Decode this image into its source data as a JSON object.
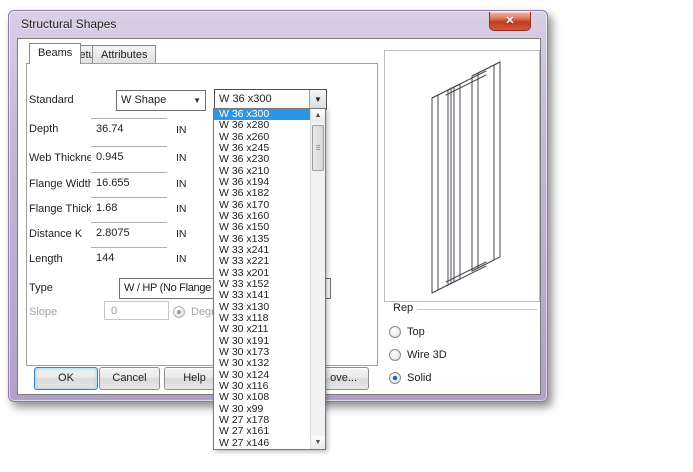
{
  "window": {
    "title": "Structural Shapes",
    "close_label": "x"
  },
  "tabs": [
    {
      "label": "Beams",
      "active": true
    },
    {
      "label": "Setup",
      "active": false
    },
    {
      "label": "Attributes",
      "active": false
    }
  ],
  "form": {
    "standard_label": "Standard",
    "shape_combo_value": "W Shape",
    "size_combo_value": "W 36 x300",
    "fields": [
      {
        "label": "Depth",
        "value": "36.74",
        "unit": "IN"
      },
      {
        "label": "Web Thickness",
        "value": "0.945",
        "unit": "IN"
      },
      {
        "label": "Flange Width",
        "value": "16.655",
        "unit": "IN"
      },
      {
        "label": "Flange Thickness",
        "value": "1.68",
        "unit": "IN"
      },
      {
        "label": "Distance K",
        "value": "2.8075",
        "unit": "IN"
      },
      {
        "label": "Length",
        "value": "144",
        "unit": "IN"
      }
    ],
    "type_label": "Type",
    "type_value": "W / HP (No Flange Slop",
    "slope_label": "Slope",
    "slope_value": "0",
    "slope_unit_label": "Degree",
    "slope_unit_checked": true
  },
  "size_dropdown": {
    "selected_index": 0,
    "items": [
      "W 36 x300",
      "W 36 x280",
      "W 36 x260",
      "W 36 x245",
      "W 36 x230",
      "W 36 x210",
      "W 36 x194",
      "W 36 x182",
      "W 36 x170",
      "W 36 x160",
      "W 36 x150",
      "W 36 x135",
      "W 33 x241",
      "W 33 x221",
      "W 33 x201",
      "W 33 x152",
      "W 33 x141",
      "W 33 x130",
      "W 33 x118",
      "W 30 x211",
      "W 30 x191",
      "W 30 x173",
      "W 30 x132",
      "W 30 x124",
      "W 30 x116",
      "W 30 x108",
      "W 30 x99",
      "W 27 x178",
      "W 27 x161",
      "W 27 x146"
    ]
  },
  "buttons": {
    "ok_label": "OK",
    "cancel_label": "Cancel",
    "help_label": "Help",
    "partial_label": "ove..."
  },
  "rep": {
    "label": "Rep",
    "options": [
      {
        "label": "Top",
        "selected": false
      },
      {
        "label": "Wire 3D",
        "selected": false
      },
      {
        "label": "Solid",
        "selected": true
      }
    ]
  },
  "colors": {
    "selection_blue": "#2e95e2",
    "frame_purple": "#bdaccf",
    "close_red": "#c33c24"
  }
}
